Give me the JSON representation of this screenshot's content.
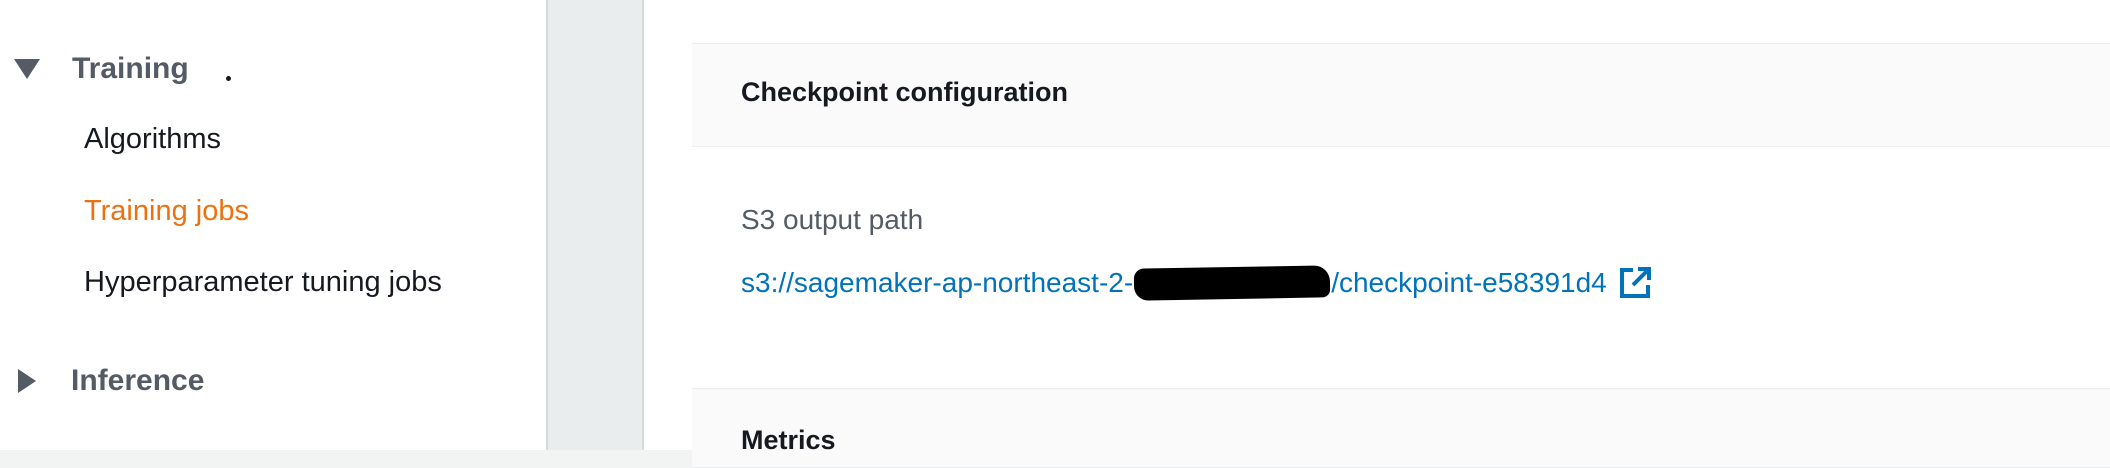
{
  "sidebar": {
    "training": {
      "label": "Training",
      "items": [
        {
          "label": "Algorithms"
        },
        {
          "label": "Training jobs"
        },
        {
          "label": "Hyperparameter tuning jobs"
        }
      ]
    },
    "inference": {
      "label": "Inference"
    }
  },
  "main": {
    "checkpoint_panel": {
      "title": "Checkpoint configuration",
      "s3_output_path_label": "S3 output path",
      "s3_link_prefix": "s3://sagemaker-ap-northeast-2-",
      "s3_link_suffix": "/checkpoint-e58391d4",
      "link_icon": "external-link-icon"
    },
    "metrics_panel": {
      "title": "Metrics"
    }
  },
  "colors": {
    "active_nav": "#ec7211",
    "link": "#0073bb",
    "text_primary": "#16191f",
    "text_secondary": "#545b64"
  }
}
